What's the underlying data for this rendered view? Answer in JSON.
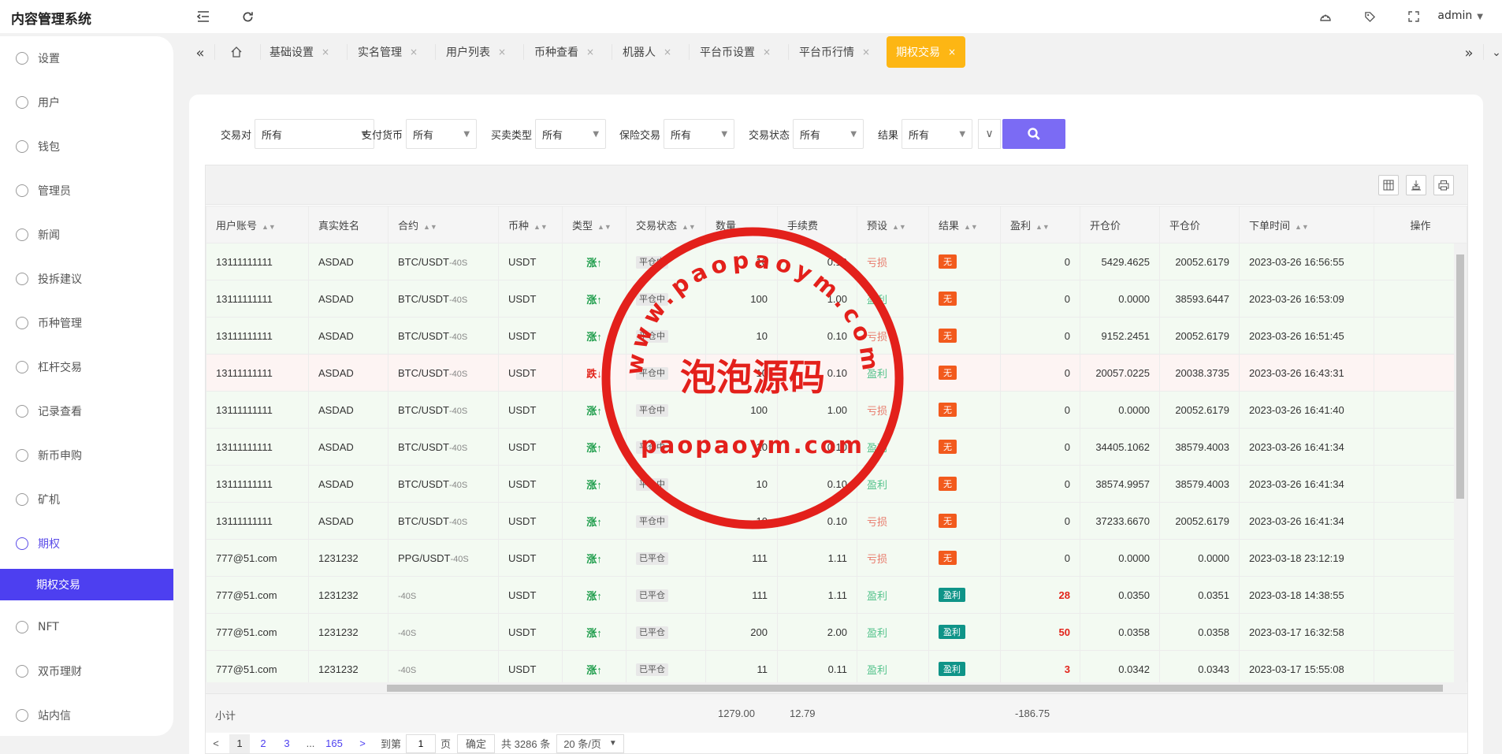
{
  "app": {
    "title": "内容管理系统",
    "user": "admin"
  },
  "sidebar": {
    "items": [
      {
        "label": "设置",
        "icon": "gear-icon"
      },
      {
        "label": "用户",
        "icon": "user-icon"
      },
      {
        "label": "钱包",
        "icon": "dollar-icon"
      },
      {
        "label": "管理员",
        "icon": "shield-icon"
      },
      {
        "label": "新闻",
        "icon": "tag-icon"
      },
      {
        "label": "投拆建议",
        "icon": "link-icon"
      },
      {
        "label": "币种管理",
        "icon": "diamond-icon"
      },
      {
        "label": "杠杆交易",
        "icon": "diamond-icon"
      },
      {
        "label": "记录查看",
        "icon": "clock-icon"
      },
      {
        "label": "新币申购",
        "icon": "dollar-icon"
      },
      {
        "label": "矿机",
        "icon": "clock-icon"
      },
      {
        "label": "期权",
        "icon": "clock-icon"
      },
      {
        "label": "NFT",
        "icon": "clock-icon"
      },
      {
        "label": "双币理财",
        "icon": "clock-icon"
      },
      {
        "label": "站内信",
        "icon": "bell-icon"
      }
    ],
    "active_sub": "期权交易"
  },
  "tabs": [
    {
      "label": "基础设置"
    },
    {
      "label": "实名管理"
    },
    {
      "label": "用户列表"
    },
    {
      "label": "币种查看"
    },
    {
      "label": "机器人"
    },
    {
      "label": "平台币设置"
    },
    {
      "label": "平台币行情"
    },
    {
      "label": "期权交易"
    }
  ],
  "tab_close": "×",
  "filters": {
    "pair": {
      "label": "交易对",
      "value": "所有"
    },
    "pay": {
      "label": "支付货币",
      "value": "所有"
    },
    "side": {
      "label": "买卖类型",
      "value": "所有"
    },
    "insure": {
      "label": "保险交易",
      "value": "所有"
    },
    "status": {
      "label": "交易状态",
      "value": "所有"
    },
    "result": {
      "label": "结果",
      "value": "所有"
    }
  },
  "table": {
    "headers": {
      "account": "用户账号",
      "name": "真实姓名",
      "contract": "合约",
      "coin": "币种",
      "type": "类型",
      "status": "交易状态",
      "qty": "数量",
      "fee": "手续费",
      "preset": "预设",
      "result": "结果",
      "pnl": "盈利",
      "open": "开仓价",
      "close": "平仓价",
      "time": "下单时间",
      "op": "操作"
    },
    "rows": [
      {
        "account": "13111111111",
        "name": "ASDAD",
        "pair": "BTC/USDT",
        "period": "-40S",
        "coin": "USDT",
        "type": "涨↑",
        "dir": "up",
        "status": "平仓中",
        "qty": "10",
        "fee": "0.10",
        "preset": "亏损",
        "preset_kind": "loss",
        "result": "无",
        "result_kind": "none",
        "pnl": "0",
        "open": "5429.4625",
        "close": "20052.6179",
        "time": "2023-03-26 16:56:55"
      },
      {
        "account": "13111111111",
        "name": "ASDAD",
        "pair": "BTC/USDT",
        "period": "-40S",
        "coin": "USDT",
        "type": "涨↑",
        "dir": "up",
        "status": "平仓中",
        "qty": "100",
        "fee": "1.00",
        "preset": "盈利",
        "preset_kind": "gain",
        "result": "无",
        "result_kind": "none",
        "pnl": "0",
        "open": "0.0000",
        "close": "38593.6447",
        "time": "2023-03-26 16:53:09"
      },
      {
        "account": "13111111111",
        "name": "ASDAD",
        "pair": "BTC/USDT",
        "period": "-40S",
        "coin": "USDT",
        "type": "涨↑",
        "dir": "up",
        "status": "平仓中",
        "qty": "10",
        "fee": "0.10",
        "preset": "亏损",
        "preset_kind": "loss",
        "result": "无",
        "result_kind": "none",
        "pnl": "0",
        "open": "9152.2451",
        "close": "20052.6179",
        "time": "2023-03-26 16:51:45"
      },
      {
        "account": "13111111111",
        "name": "ASDAD",
        "pair": "BTC/USDT",
        "period": "-40S",
        "coin": "USDT",
        "type": "跌↓",
        "dir": "down",
        "status": "平仓中",
        "qty": "10",
        "fee": "0.10",
        "preset": "盈利",
        "preset_kind": "gain",
        "result": "无",
        "result_kind": "none",
        "pnl": "0",
        "open": "20057.0225",
        "close": "20038.3735",
        "time": "2023-03-26 16:43:31"
      },
      {
        "account": "13111111111",
        "name": "ASDAD",
        "pair": "BTC/USDT",
        "period": "-40S",
        "coin": "USDT",
        "type": "涨↑",
        "dir": "up",
        "status": "平仓中",
        "qty": "100",
        "fee": "1.00",
        "preset": "亏损",
        "preset_kind": "loss",
        "result": "无",
        "result_kind": "none",
        "pnl": "0",
        "open": "0.0000",
        "close": "20052.6179",
        "time": "2023-03-26 16:41:40"
      },
      {
        "account": "13111111111",
        "name": "ASDAD",
        "pair": "BTC/USDT",
        "period": "-40S",
        "coin": "USDT",
        "type": "涨↑",
        "dir": "up",
        "status": "平仓中",
        "qty": "10",
        "fee": "0.10",
        "preset": "盈利",
        "preset_kind": "gain",
        "result": "无",
        "result_kind": "none",
        "pnl": "0",
        "open": "34405.1062",
        "close": "38579.4003",
        "time": "2023-03-26 16:41:34"
      },
      {
        "account": "13111111111",
        "name": "ASDAD",
        "pair": "BTC/USDT",
        "period": "-40S",
        "coin": "USDT",
        "type": "涨↑",
        "dir": "up",
        "status": "平仓中",
        "qty": "10",
        "fee": "0.10",
        "preset": "盈利",
        "preset_kind": "gain",
        "result": "无",
        "result_kind": "none",
        "pnl": "0",
        "open": "38574.9957",
        "close": "38579.4003",
        "time": "2023-03-26 16:41:34"
      },
      {
        "account": "13111111111",
        "name": "ASDAD",
        "pair": "BTC/USDT",
        "period": "-40S",
        "coin": "USDT",
        "type": "涨↑",
        "dir": "up",
        "status": "平仓中",
        "qty": "10",
        "fee": "0.10",
        "preset": "亏损",
        "preset_kind": "loss",
        "result": "无",
        "result_kind": "none",
        "pnl": "0",
        "open": "37233.6670",
        "close": "20052.6179",
        "time": "2023-03-26 16:41:34"
      },
      {
        "account": "777@51.com",
        "name": "1231232",
        "pair": "PPG/USDT",
        "period": "-40S",
        "coin": "USDT",
        "type": "涨↑",
        "dir": "up",
        "status": "已平仓",
        "qty": "111",
        "fee": "1.11",
        "preset": "亏损",
        "preset_kind": "loss",
        "result": "无",
        "result_kind": "none",
        "pnl": "0",
        "open": "0.0000",
        "close": "0.0000",
        "time": "2023-03-18 23:12:19"
      },
      {
        "account": "777@51.com",
        "name": "1231232",
        "pair": "",
        "period": "-40S",
        "coin": "USDT",
        "type": "涨↑",
        "dir": "up",
        "status": "已平仓",
        "qty": "111",
        "fee": "1.11",
        "preset": "盈利",
        "preset_kind": "gain",
        "result": "盈利",
        "result_kind": "win",
        "pnl": "28",
        "open": "0.0350",
        "close": "0.0351",
        "time": "2023-03-18 14:38:55"
      },
      {
        "account": "777@51.com",
        "name": "1231232",
        "pair": "",
        "period": "-40S",
        "coin": "USDT",
        "type": "涨↑",
        "dir": "up",
        "status": "已平仓",
        "qty": "200",
        "fee": "2.00",
        "preset": "盈利",
        "preset_kind": "gain",
        "result": "盈利",
        "result_kind": "win",
        "pnl": "50",
        "open": "0.0358",
        "close": "0.0358",
        "time": "2023-03-17 16:32:58"
      },
      {
        "account": "777@51.com",
        "name": "1231232",
        "pair": "",
        "period": "-40S",
        "coin": "USDT",
        "type": "涨↑",
        "dir": "up",
        "status": "已平仓",
        "qty": "11",
        "fee": "0.11",
        "preset": "盈利",
        "preset_kind": "gain",
        "result": "盈利",
        "result_kind": "win",
        "pnl": "3",
        "open": "0.0342",
        "close": "0.0343",
        "time": "2023-03-17 15:55:08"
      }
    ],
    "subtotal": {
      "label": "小计",
      "qty": "1279.00",
      "fee": "12.79",
      "pnl": "-186.75"
    }
  },
  "pagination": {
    "prev": "<",
    "next": ">",
    "pages": [
      "1",
      "2",
      "3"
    ],
    "ellipsis": "...",
    "last": "165",
    "goto_label": "到第",
    "goto_value": "1",
    "page_unit": "页",
    "confirm": "确定",
    "total": "共 3286 条",
    "page_size": "20 条/页"
  },
  "watermark": {
    "top": "www.paopaoym.com",
    "center": "泡泡源码",
    "bottom": "paopaoym.com",
    "color": "#e3201b"
  }
}
